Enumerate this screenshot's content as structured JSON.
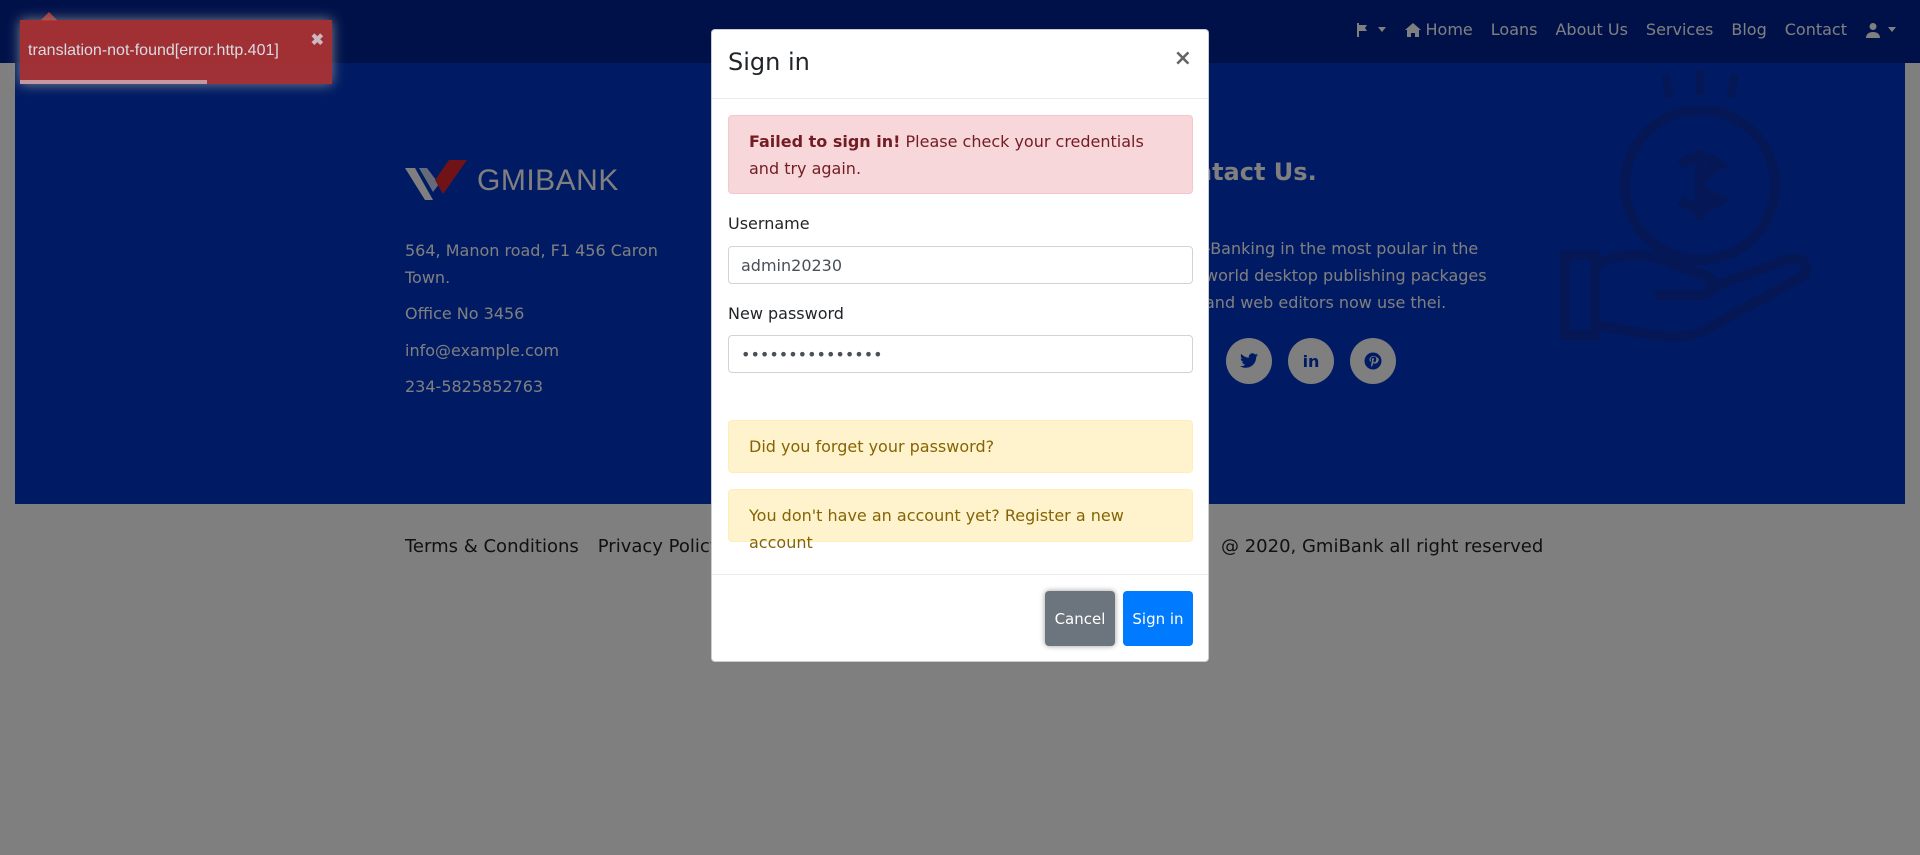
{
  "navbar": {
    "items": [
      {
        "label": "",
        "icon": "flag-icon"
      },
      {
        "label": "Home",
        "icon": "home-icon"
      },
      {
        "label": "Loans"
      },
      {
        "label": "About Us"
      },
      {
        "label": "Services"
      },
      {
        "label": "Blog"
      },
      {
        "label": "Contact"
      },
      {
        "label": "",
        "icon": "user-icon"
      }
    ]
  },
  "footer": {
    "brand": "GMIBANK",
    "address_line": "564, Manon road, F1 456 Caron Town.",
    "office": "Office No 3456",
    "email": "info@example.com",
    "phone": "234-5825852763",
    "contact_title": "ntact Us.",
    "contact_text": "-Banking in the most poular in the world desktop publishing packages and web editors now use thei.",
    "social": [
      "twitter-icon",
      "linkedin-icon",
      "pinterest-icon"
    ],
    "links": [
      "Terms & Conditions",
      "Privacy Policy"
    ],
    "copyright": "@ 2020, GmiBank all right reserved"
  },
  "toast": {
    "message": "translation-not-found[error.http.401]",
    "close": "✖",
    "progress": 0.6
  },
  "modal": {
    "title": "Sign in",
    "close": "×",
    "error_bold": "Failed to sign in!",
    "error_text": " Please check your credentials and try again.",
    "username_label": "Username",
    "username_value": "admin20230",
    "password_label": "New password",
    "password_value": "•••••••••••••••",
    "forgot_password": "Did you forget your password?",
    "register_prompt": "You don't have an account yet? Register a new account",
    "cancel_label": "Cancel",
    "signin_label": "Sign in"
  }
}
